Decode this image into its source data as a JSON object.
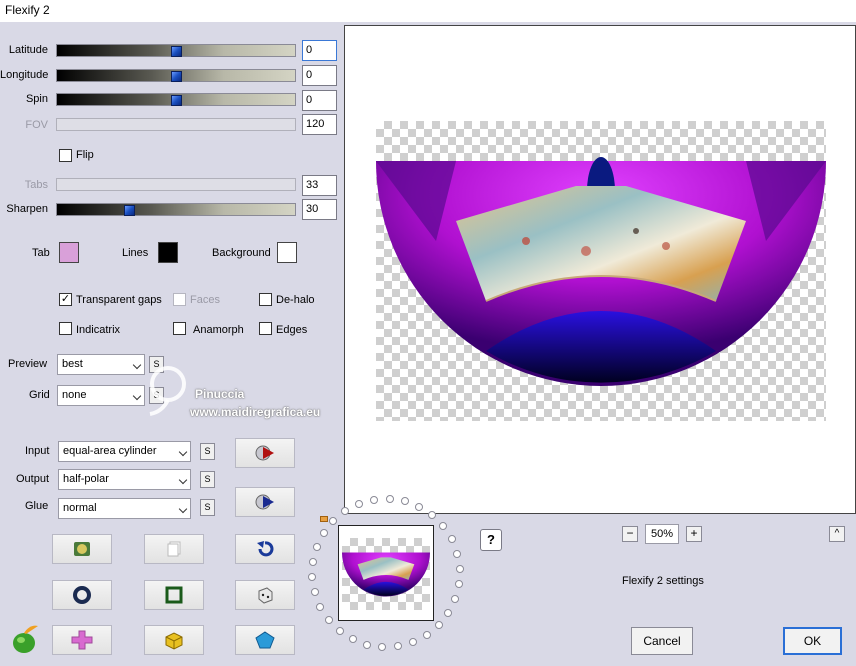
{
  "window": {
    "title": "Flexify 2"
  },
  "sliders": [
    {
      "label": "Latitude",
      "value": "0",
      "level": 0.5,
      "enabled": true
    },
    {
      "label": "Longitude",
      "value": "0",
      "level": 0.5,
      "enabled": true
    },
    {
      "label": "Spin",
      "value": "0",
      "level": 0.5,
      "enabled": true
    },
    {
      "label": "FOV",
      "value": "120",
      "level": 0,
      "enabled": false
    },
    {
      "label": "Tabs",
      "value": "33",
      "level": 0,
      "enabled": false
    },
    {
      "label": "Sharpen",
      "value": "30",
      "level": 0.3,
      "enabled": true
    }
  ],
  "flip": {
    "label": "Flip",
    "checked": false
  },
  "colors": {
    "tab": {
      "label": "Tab",
      "color": "#d9a0d9"
    },
    "lines": {
      "label": "Lines",
      "color": "#000000"
    },
    "background": {
      "label": "Background",
      "color": "#ffffff"
    }
  },
  "options": {
    "transparent_gaps": {
      "label": "Transparent gaps",
      "checked": true
    },
    "faces": {
      "label": "Faces",
      "checked": false
    },
    "dehalo": {
      "label": "De-halo",
      "checked": false
    },
    "indicatrix": {
      "label": "Indicatrix",
      "checked": false
    },
    "anamorph": {
      "label": "Anamorph",
      "checked": false
    },
    "edges": {
      "label": "Edges",
      "checked": false
    }
  },
  "preview_select": {
    "label": "Preview",
    "value": "best"
  },
  "grid_select": {
    "label": "Grid",
    "value": "none"
  },
  "projection": {
    "input": {
      "label": "Input",
      "value": "equal-area cylinder"
    },
    "output": {
      "label": "Output",
      "value": "half-polar"
    },
    "glue": {
      "label": "Glue",
      "value": "normal"
    }
  },
  "s_label": "S",
  "watermark": {
    "line1": "Pinuccia",
    "line2": "www.maidiregrafica.eu"
  },
  "zoom": {
    "minus": "−",
    "value": "50%",
    "plus": "+"
  },
  "help_label": "?",
  "collapse_label": "^",
  "settings_name": "Flexify 2 settings",
  "buttons": {
    "cancel": "Cancel",
    "ok": "OK"
  },
  "accent": "#2a6fd6"
}
